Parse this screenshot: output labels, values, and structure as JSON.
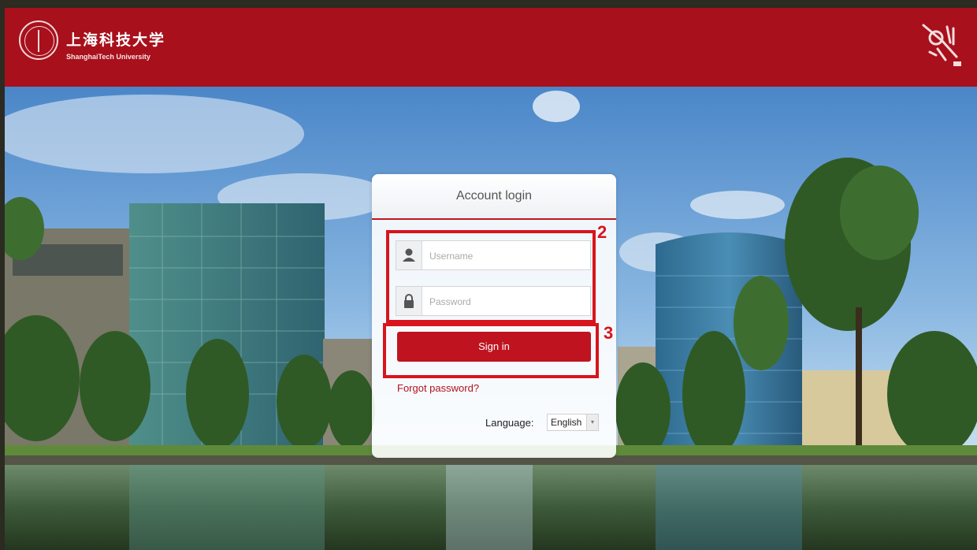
{
  "header": {
    "logo_cn": "上海科技大学",
    "logo_en": "ShanghaiTech University",
    "brand_color": "#a8101c"
  },
  "login": {
    "title": "Account login",
    "username_placeholder": "Username",
    "password_placeholder": "Password",
    "signin_label": "Sign in",
    "forgot_label": "Forgot password?",
    "language_label": "Language:",
    "language_value": "English"
  },
  "annotations": {
    "credentials_number": "2",
    "signin_number": "3",
    "color": "#d8141c"
  },
  "icons": {
    "user": "user-icon",
    "lock": "lock-icon",
    "dropdown": "chevron-down-icon"
  }
}
